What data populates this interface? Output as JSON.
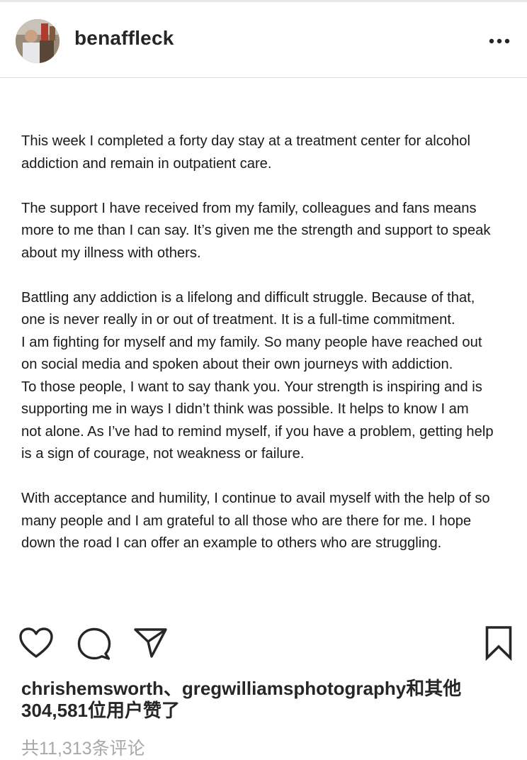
{
  "header": {
    "username": "benaffleck",
    "more_icon": "more-horizontal-icon"
  },
  "post": {
    "paragraphs": [
      {
        "lines": [
          "This week I completed a forty day stay at a treatment center for alcohol",
          "addiction and remain in outpatient care."
        ]
      },
      {
        "lines": [
          "The support I have received from my family, colleagues and fans means",
          "more to me than I can say.  It’s given me the strength and support to speak",
          "about my illness with others."
        ]
      },
      {
        "lines": [
          "Battling any addiction is a lifelong and difficult struggle. Because of that,",
          "one is never really in or out of treatment. It is a full-time commitment.",
          "I am fighting for myself and my family. So many people have reached out",
          "on social media and spoken about their own journeys with addiction.",
          "To those people, I want to say thank you.  Your strength is inspiring and is",
          "supporting me in ways I didn’t think was possible. It helps to know I am",
          "not alone. As I’ve had to remind myself, if you have a problem, getting help",
          "is a sign of courage, not weakness or failure."
        ]
      },
      {
        "lines": [
          "With acceptance and humility, I continue to avail myself with the help of so",
          "many people and I am grateful to all those who are there for me. I hope",
          "down the road I can offer an example to others who are struggling."
        ]
      }
    ]
  },
  "actions": {
    "like_icon": "heart-icon",
    "comment_icon": "comment-icon",
    "share_icon": "send-icon",
    "save_icon": "bookmark-icon"
  },
  "likes": {
    "line1": "chrishemsworth、gregwilliamsphotography和其他",
    "line2": "304,581位用户赞了"
  },
  "comments": {
    "link_text": "共11,313条评论"
  },
  "colors": {
    "text": "#262626",
    "muted": "#a8a8a8",
    "divider": "#dbdbdb"
  }
}
